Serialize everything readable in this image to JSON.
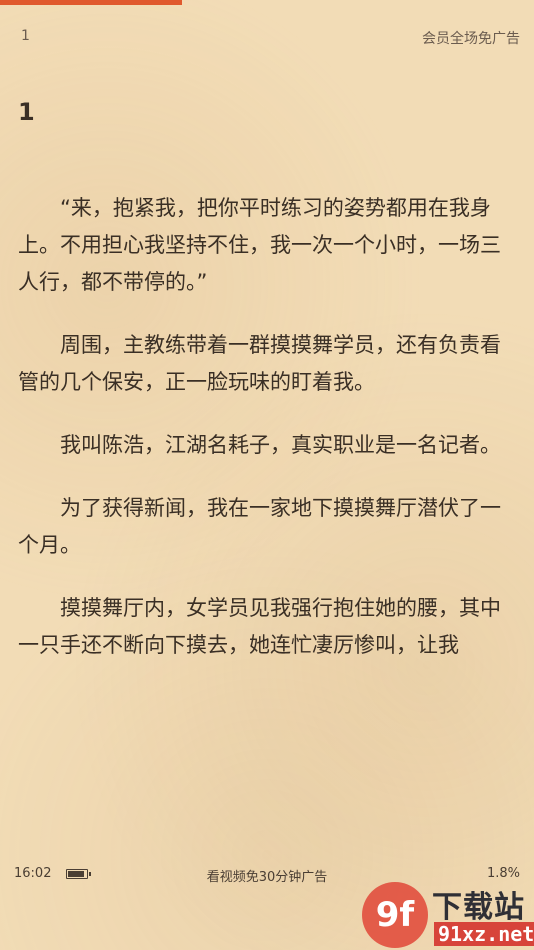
{
  "reader": {
    "progress_fraction": 0.34,
    "chapter_indicator": "1",
    "vip_ad_free": "会员全场免广告",
    "chapter_title": "1",
    "paragraphs": [
      "“来，抱紧我，把你平时练习的姿势都用在我身上。不用担心我坚持不住，我一次一个小时，一场三人行，都不带停的。”",
      "周围，主教练带着一群摸摸舞学员，还有负责看管的几个保安，正一脸玩味的盯着我。",
      "我叫陈浩，江湖名耗子，真实职业是一名记者。",
      "为了获得新闻，我在一家地下摸摸舞厅潜伏了一个月。",
      "摸摸舞厅内，女学员见我强行抱住她的腰，其中一只手还不断向下摸去，她连忙凄厉惨叫，让我"
    ]
  },
  "status_bar": {
    "time": "16:02",
    "battery_icon": "battery-icon",
    "video_ad": "看视频免30分钟广告",
    "progress": "1.8%"
  },
  "watermark": {
    "logo_text": "9f",
    "title": "下载站",
    "url": "91xz.net"
  },
  "colors": {
    "accent": "#e0592d",
    "background": "#f2dcb6",
    "text": "#3a2f25"
  }
}
